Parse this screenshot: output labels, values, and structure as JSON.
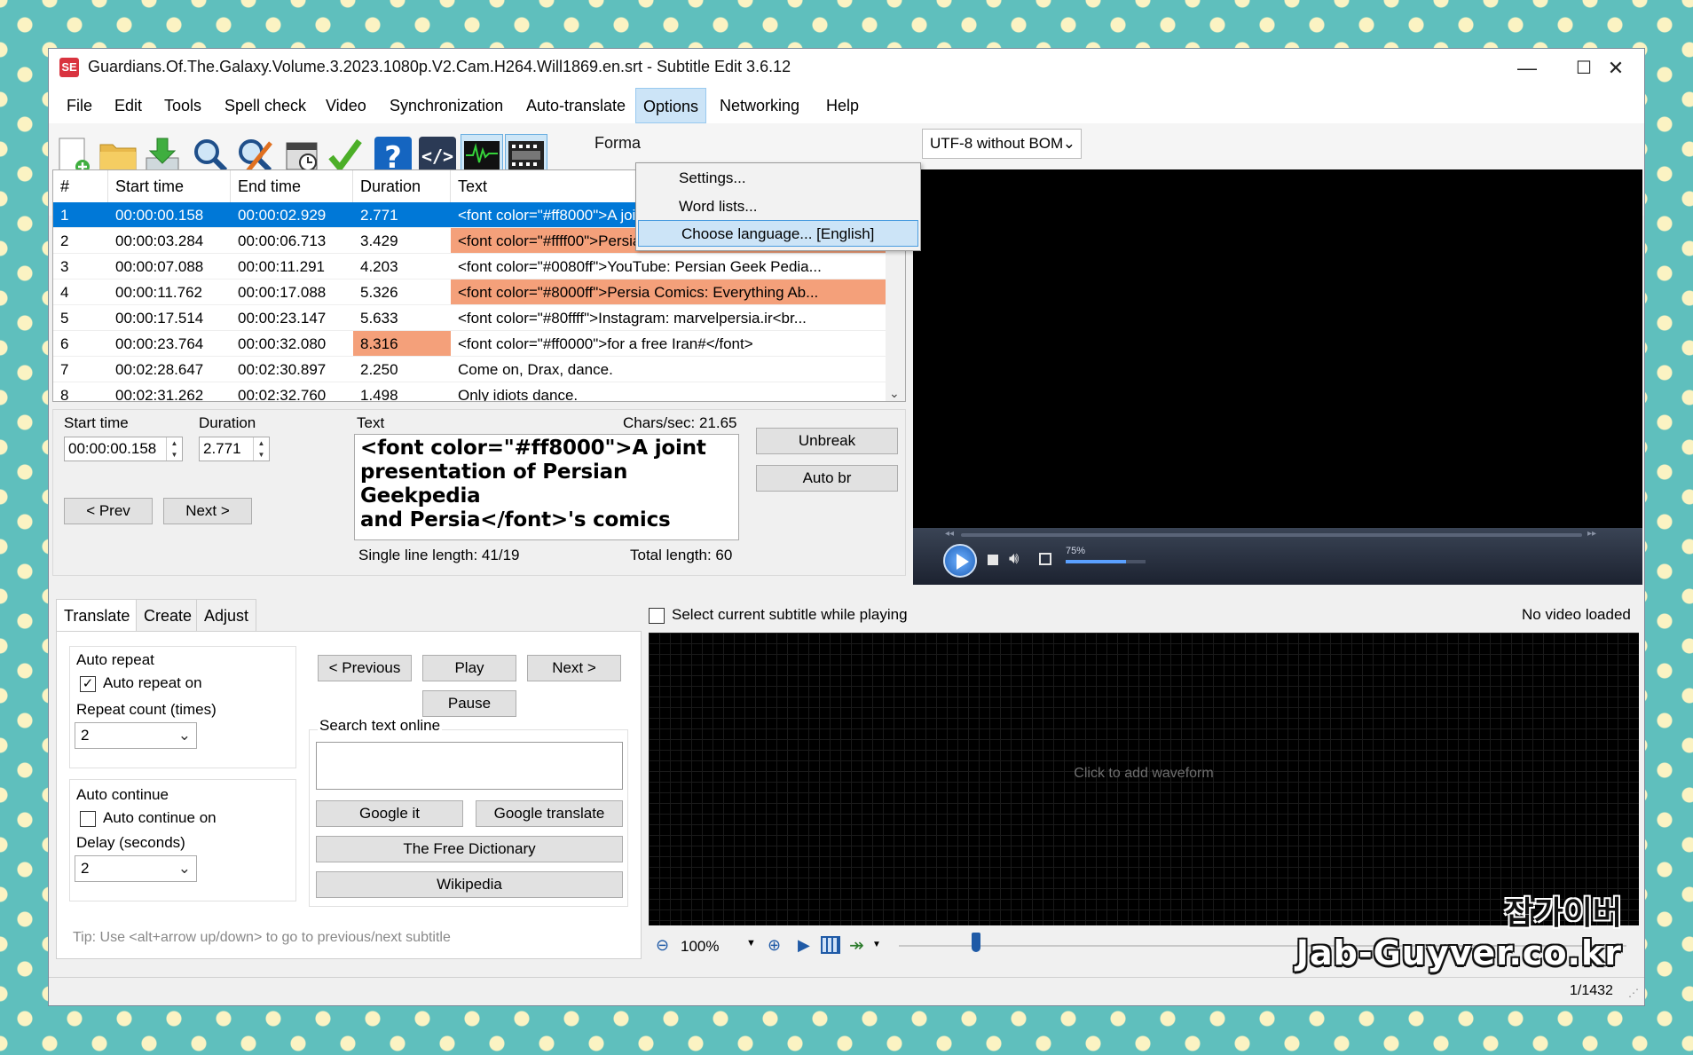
{
  "window": {
    "title": "Guardians.Of.The.Galaxy.Volume.3.2023.1080p.V2.Cam.H264.Will1869.en.srt - Subtitle Edit 3.6.12",
    "app_icon": "SE",
    "minimize": "—",
    "maximize": "☐",
    "close": "✕"
  },
  "menubar": [
    "File",
    "Edit",
    "Tools",
    "Spell check",
    "Video",
    "Synchronization",
    "Auto-translate",
    "Options",
    "Networking",
    "Help"
  ],
  "options_menu": {
    "items": [
      "Settings...",
      "Word lists...",
      "Choose language... [English]"
    ],
    "highlighted_index": 2
  },
  "toolbar": {
    "format_label": "Forma",
    "encoding": "UTF-8 without BOM",
    "icons": [
      "new-file-icon",
      "open-folder-icon",
      "download-icon",
      "find-icon",
      "replace-icon",
      "visual-sync-icon",
      "spell-check-icon",
      "help-icon",
      "source-view-icon",
      "waveform-toggle-icon",
      "video-toggle-icon"
    ]
  },
  "grid": {
    "headers": [
      "#",
      "Start time",
      "End time",
      "Duration",
      "Text"
    ],
    "rows": [
      {
        "n": "1",
        "start": "00:00:00.158",
        "end": "00:00:02.929",
        "dur": "2.771",
        "text": "<font color=\"#ff8000\">A joint presentation of Persia...",
        "selected": true,
        "warn_text": false,
        "warn_dur": false
      },
      {
        "n": "2",
        "start": "00:00:03.284",
        "end": "00:00:06.713",
        "dur": "3.429",
        "text": "<font color=\"#ffff00\">Persian Geek Pedia<br />The ...",
        "selected": false,
        "warn_text": true,
        "warn_dur": false
      },
      {
        "n": "3",
        "start": "00:00:07.088",
        "end": "00:00:11.291",
        "dur": "4.203",
        "text": "<font color=\"#0080ff\">YouTube: Persian Geek Pedia...",
        "selected": false,
        "warn_text": false,
        "warn_dur": false
      },
      {
        "n": "4",
        "start": "00:00:11.762",
        "end": "00:00:17.088",
        "dur": "5.326",
        "text": "<font color=\"#8000ff\">Persia Comics: Everything Ab...",
        "selected": false,
        "warn_text": true,
        "warn_dur": false
      },
      {
        "n": "5",
        "start": "00:00:17.514",
        "end": "00:00:23.147",
        "dur": "5.633",
        "text": "<font color=\"#80ffff\">Instagram: marvelpersia.ir<br...",
        "selected": false,
        "warn_text": false,
        "warn_dur": false
      },
      {
        "n": "6",
        "start": "00:00:23.764",
        "end": "00:00:32.080",
        "dur": "8.316",
        "text": "<font color=\"#ff0000\">for a free Iran#</font>",
        "selected": false,
        "warn_text": false,
        "warn_dur": true
      },
      {
        "n": "7",
        "start": "00:02:28.647",
        "end": "00:02:30.897",
        "dur": "2.250",
        "text": "Come on, Drax, dance.",
        "selected": false,
        "warn_text": false,
        "warn_dur": false
      },
      {
        "n": "8",
        "start": "00:02:31.262",
        "end": "00:02:32.760",
        "dur": "1.498",
        "text": "Only idiots dance.",
        "selected": false,
        "warn_text": false,
        "warn_dur": false
      }
    ]
  },
  "editor": {
    "start_time_label": "Start time",
    "start_time": "00:00:00.158",
    "duration_label": "Duration",
    "duration": "2.771",
    "text_label": "Text",
    "chars_sec": "Chars/sec: 21.65",
    "text_line1": "<font color=\"#ff8000\">A joint",
    "text_line2": "presentation of Persian Geekpedia",
    "text_line3": "and Persia</font>'s comics",
    "unbreak": "Unbreak",
    "auto_br": "Auto br",
    "prev": "< Prev",
    "next": "Next >",
    "single_line_length": "Single line length: 41/19",
    "total_length": "Total length: 60"
  },
  "video": {
    "volume_label": "75%",
    "volume_fraction": 0.75
  },
  "tabs": [
    "Translate",
    "Create",
    "Adjust"
  ],
  "translate": {
    "auto_repeat_group": "Auto repeat",
    "auto_repeat_on": "Auto repeat on",
    "auto_repeat_checked": true,
    "repeat_count_label": "Repeat count (times)",
    "repeat_count": "2",
    "auto_continue_group": "Auto continue",
    "auto_continue_on": "Auto continue on",
    "auto_continue_checked": false,
    "delay_label": "Delay (seconds)",
    "delay": "2",
    "previous": "< Previous",
    "play": "Play",
    "next": "Next >",
    "pause": "Pause",
    "search_label": "Search text online",
    "search_value": "",
    "google_it": "Google it",
    "google_translate": "Google translate",
    "free_dictionary": "The Free Dictionary",
    "wikipedia": "Wikipedia",
    "tip": "Tip: Use <alt+arrow up/down> to go to previous/next subtitle"
  },
  "waveform": {
    "select_current_label": "Select current subtitle while playing",
    "select_current_checked": false,
    "no_video": "No video loaded",
    "click_to_add": "Click to add waveform",
    "zoom": "100%"
  },
  "status": {
    "position": "1/1432"
  },
  "watermark": {
    "korean": "잡가이버",
    "url": "Jab-Guyver.co.kr"
  },
  "colors": {
    "selection": "#0078d7",
    "warning": "#f4a07a",
    "background": "#5fbfbd",
    "dots": "#fbf3c3"
  }
}
